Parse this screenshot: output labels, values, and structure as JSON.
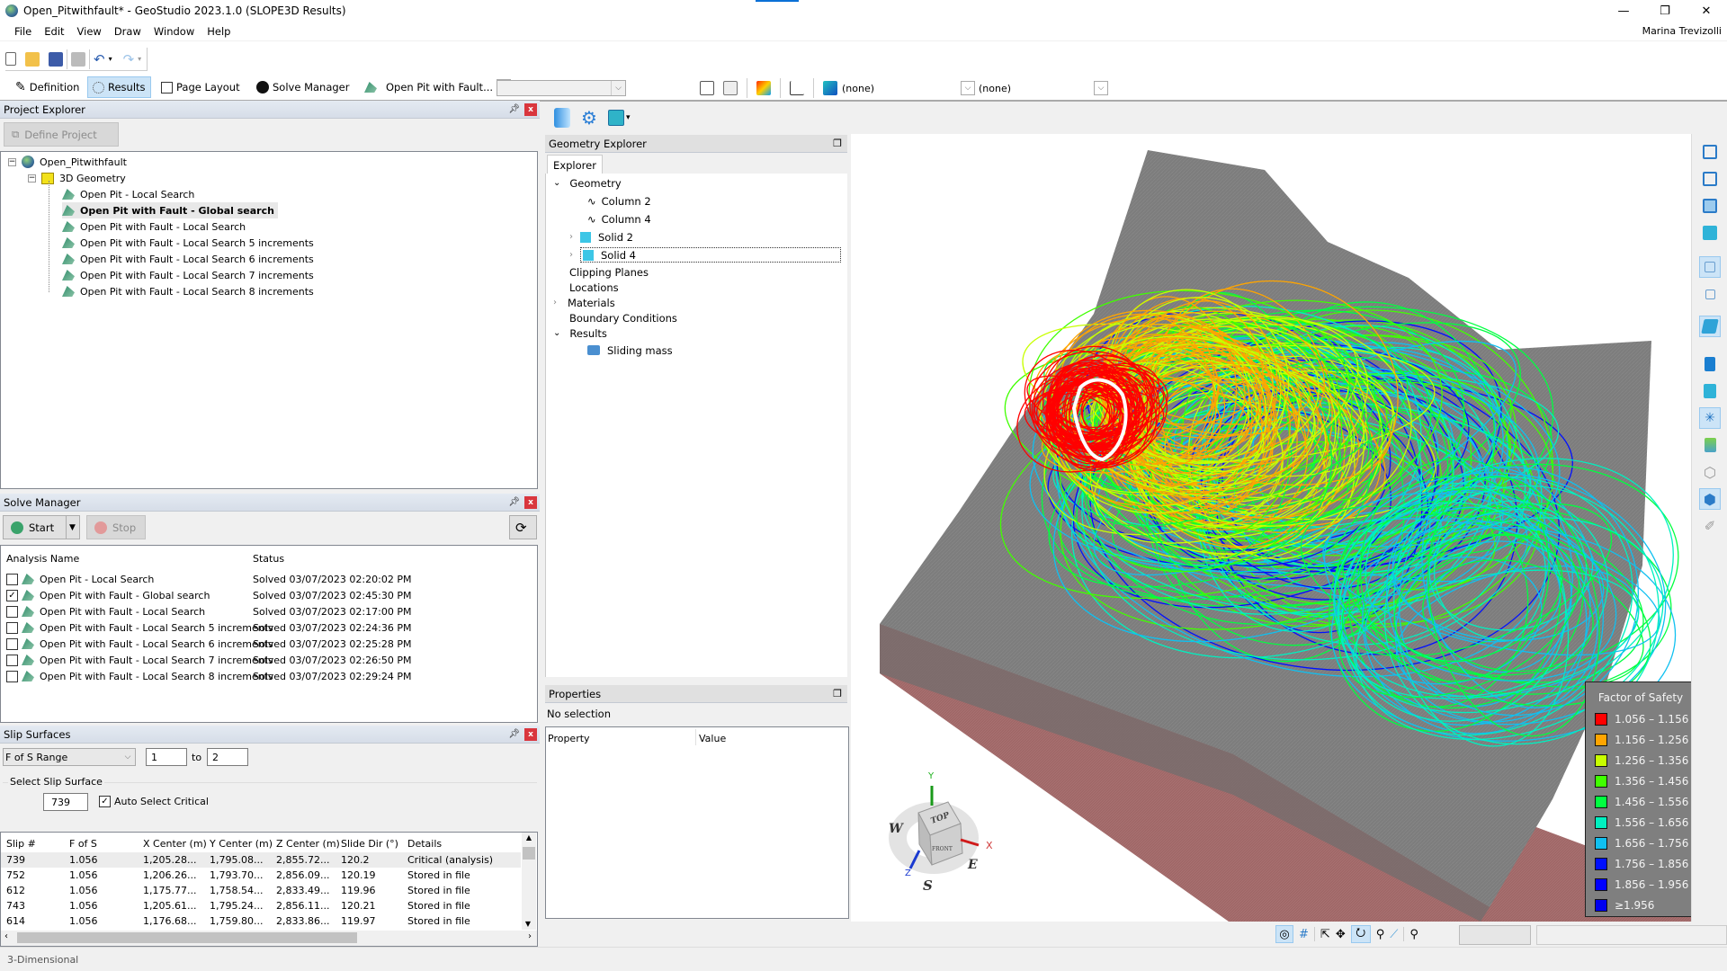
{
  "window": {
    "title": "Open_Pitwithfault* - GeoStudio 2023.1.0 (SLOPE3D Results)",
    "user": "Marina Trevizolli",
    "minimize": "—",
    "restore": "❐",
    "close": "✕"
  },
  "menu": [
    "File",
    "Edit",
    "View",
    "Draw",
    "Window",
    "Help"
  ],
  "toolbar": {
    "definition": "Definition",
    "results": "Results",
    "page_layout": "Page Layout",
    "solve_manager": "Solve Manager",
    "analysis_combo": "Open Pit with Fault...",
    "combo1": "(none)",
    "combo2": "(none)"
  },
  "project_explorer": {
    "title": "Project Explorer",
    "define_project": "Define Project",
    "root": "Open_Pitwithfault",
    "geometry": "3D Geometry",
    "analyses": [
      "Open Pit - Local Search",
      "Open Pit with Fault - Global search",
      "Open Pit with Fault - Local Search",
      "Open Pit with Fault - Local Search 5 increments",
      "Open Pit with Fault - Local Search 6 increments",
      "Open Pit with Fault - Local Search 7 increments",
      "Open Pit with Fault - Local Search 8 increments"
    ],
    "selected_index": 1
  },
  "solve_manager": {
    "title": "Solve Manager",
    "start": "Start",
    "stop": "Stop",
    "col_name": "Analysis Name",
    "col_status": "Status",
    "rows": [
      {
        "name": "Open Pit - Local Search",
        "status": "Solved 03/07/2023 02:20:02 PM",
        "checked": false
      },
      {
        "name": "Open Pit with Fault - Global search",
        "status": "Solved 03/07/2023 02:45:30 PM",
        "checked": true
      },
      {
        "name": "Open Pit with Fault - Local Search",
        "status": "Solved 03/07/2023 02:17:00 PM",
        "checked": false
      },
      {
        "name": "Open Pit with Fault - Local Search 5 increments",
        "status": "Solved 03/07/2023 02:24:36 PM",
        "checked": false
      },
      {
        "name": "Open Pit with Fault - Local Search 6 increments",
        "status": "Solved 03/07/2023 02:25:28 PM",
        "checked": false
      },
      {
        "name": "Open Pit with Fault - Local Search 7 increments",
        "status": "Solved 03/07/2023 02:26:50 PM",
        "checked": false
      },
      {
        "name": "Open Pit with Fault - Local Search 8 increments",
        "status": "Solved 03/07/2023 02:29:24 PM",
        "checked": false
      }
    ]
  },
  "slip_surfaces": {
    "title": "Slip Surfaces",
    "range_mode": "F of S Range",
    "range_from": "1",
    "range_to_label": "to",
    "range_to": "2",
    "select_group": "Select Slip Surface",
    "selected_slip": "739",
    "auto_select": "Auto Select Critical",
    "auto_select_checked": true,
    "columns": [
      "Slip #",
      "F of S",
      "X Center (m)",
      "Y Center (m)",
      "Z Center (m)",
      "Slide Dir (°)",
      "Details"
    ],
    "rows": [
      [
        "739",
        "1.056",
        "1,205.28...",
        "1,795.08...",
        "2,855.72...",
        "120.2",
        "Critical (analysis)"
      ],
      [
        "752",
        "1.056",
        "1,206.26...",
        "1,793.70...",
        "2,856.09...",
        "120.19",
        "Stored in file"
      ],
      [
        "612",
        "1.056",
        "1,175.77...",
        "1,758.54...",
        "2,833.49...",
        "119.96",
        "Stored in file"
      ],
      [
        "743",
        "1.056",
        "1,205.61...",
        "1,795.24...",
        "2,856.11...",
        "120.21",
        "Stored in file"
      ],
      [
        "614",
        "1.056",
        "1,176.68...",
        "1,759.80...",
        "2,833.86...",
        "119.97",
        "Stored in file"
      ]
    ]
  },
  "geometry_explorer": {
    "title": "Geometry Explorer",
    "tab": "Explorer",
    "items": {
      "geometry": "Geometry",
      "column2": "Column 2",
      "column4": "Column 4",
      "solid2": "Solid 2",
      "solid4": "Solid 4",
      "clipping": "Clipping Planes",
      "locations": "Locations",
      "materials": "Materials",
      "boundary": "Boundary Conditions",
      "results": "Results",
      "sliding": "Sliding mass"
    }
  },
  "properties": {
    "title": "Properties",
    "selection": "No selection",
    "col_property": "Property",
    "col_value": "Value"
  },
  "legend": {
    "title": "Factor of Safety",
    "items": [
      {
        "label": "1.056 – 1.156",
        "color": "#ff0000"
      },
      {
        "label": "1.156 – 1.256",
        "color": "#ffa500"
      },
      {
        "label": "1.256 – 1.356",
        "color": "#c8ff00"
      },
      {
        "label": "1.356 – 1.456",
        "color": "#40ff00"
      },
      {
        "label": "1.456 – 1.556",
        "color": "#00ff40"
      },
      {
        "label": "1.556 – 1.656",
        "color": "#00f0c0"
      },
      {
        "label": "1.656 – 1.756",
        "color": "#10c0f0"
      },
      {
        "label": "1.756 – 1.856",
        "color": "#0010ff"
      },
      {
        "label": "1.856 – 1.956",
        "color": "#0000ff"
      },
      {
        "label": "≥1.956",
        "color": "#0000f0"
      }
    ]
  },
  "axes": {
    "y": "Y",
    "x": "X",
    "z": "Z",
    "top": "TOP",
    "front": "FRONT",
    "w": "W",
    "e": "E",
    "s": "S"
  },
  "status": {
    "mode": "3-Dimensional"
  }
}
